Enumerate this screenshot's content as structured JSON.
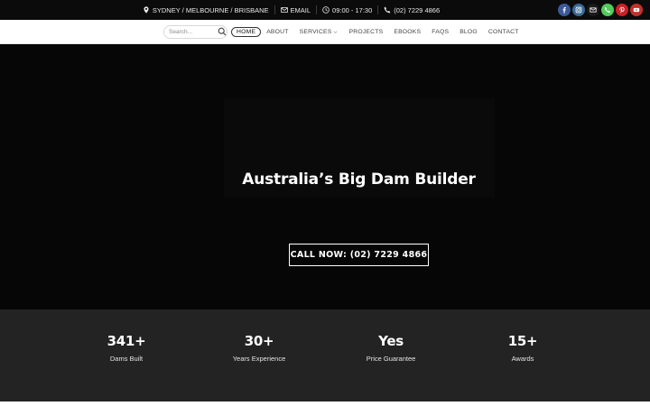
{
  "topbar": {
    "location": "SYDNEY / MELBOURNE / BRISBANE",
    "email": "EMAIL",
    "hours": "09:00 - 17:30",
    "phone": "(02) 7229 4866",
    "socials": [
      {
        "icon": "facebook-icon",
        "color": "#3b5998"
      },
      {
        "icon": "instagram-icon",
        "color": "#3b6994"
      },
      {
        "icon": "email-icon",
        "color": "#1a1a1a"
      },
      {
        "icon": "whatsapp-icon",
        "color": "#51cb5a"
      },
      {
        "icon": "pinterest-icon",
        "color": "#cb2027"
      },
      {
        "icon": "youtube-icon",
        "color": "#c4302b"
      }
    ]
  },
  "nav": {
    "search_placeholder": "Search...",
    "items": [
      "HOME",
      "ABOUT",
      "SERVICES",
      "PROJECTS",
      "EBOOKS",
      "FAQS",
      "BLOG",
      "CONTACT"
    ],
    "active": "HOME"
  },
  "hero": {
    "title": "Australia’s Big Dam Builder",
    "cta_label": "CALL NOW: (02) 7229 4866"
  },
  "stats": [
    {
      "value": "341+",
      "label": "Dams Built"
    },
    {
      "value": "30+",
      "label": "Years Experience"
    },
    {
      "value": "Yes",
      "label": "Price Guarantee"
    },
    {
      "value": "15+",
      "label": "Awards"
    }
  ]
}
